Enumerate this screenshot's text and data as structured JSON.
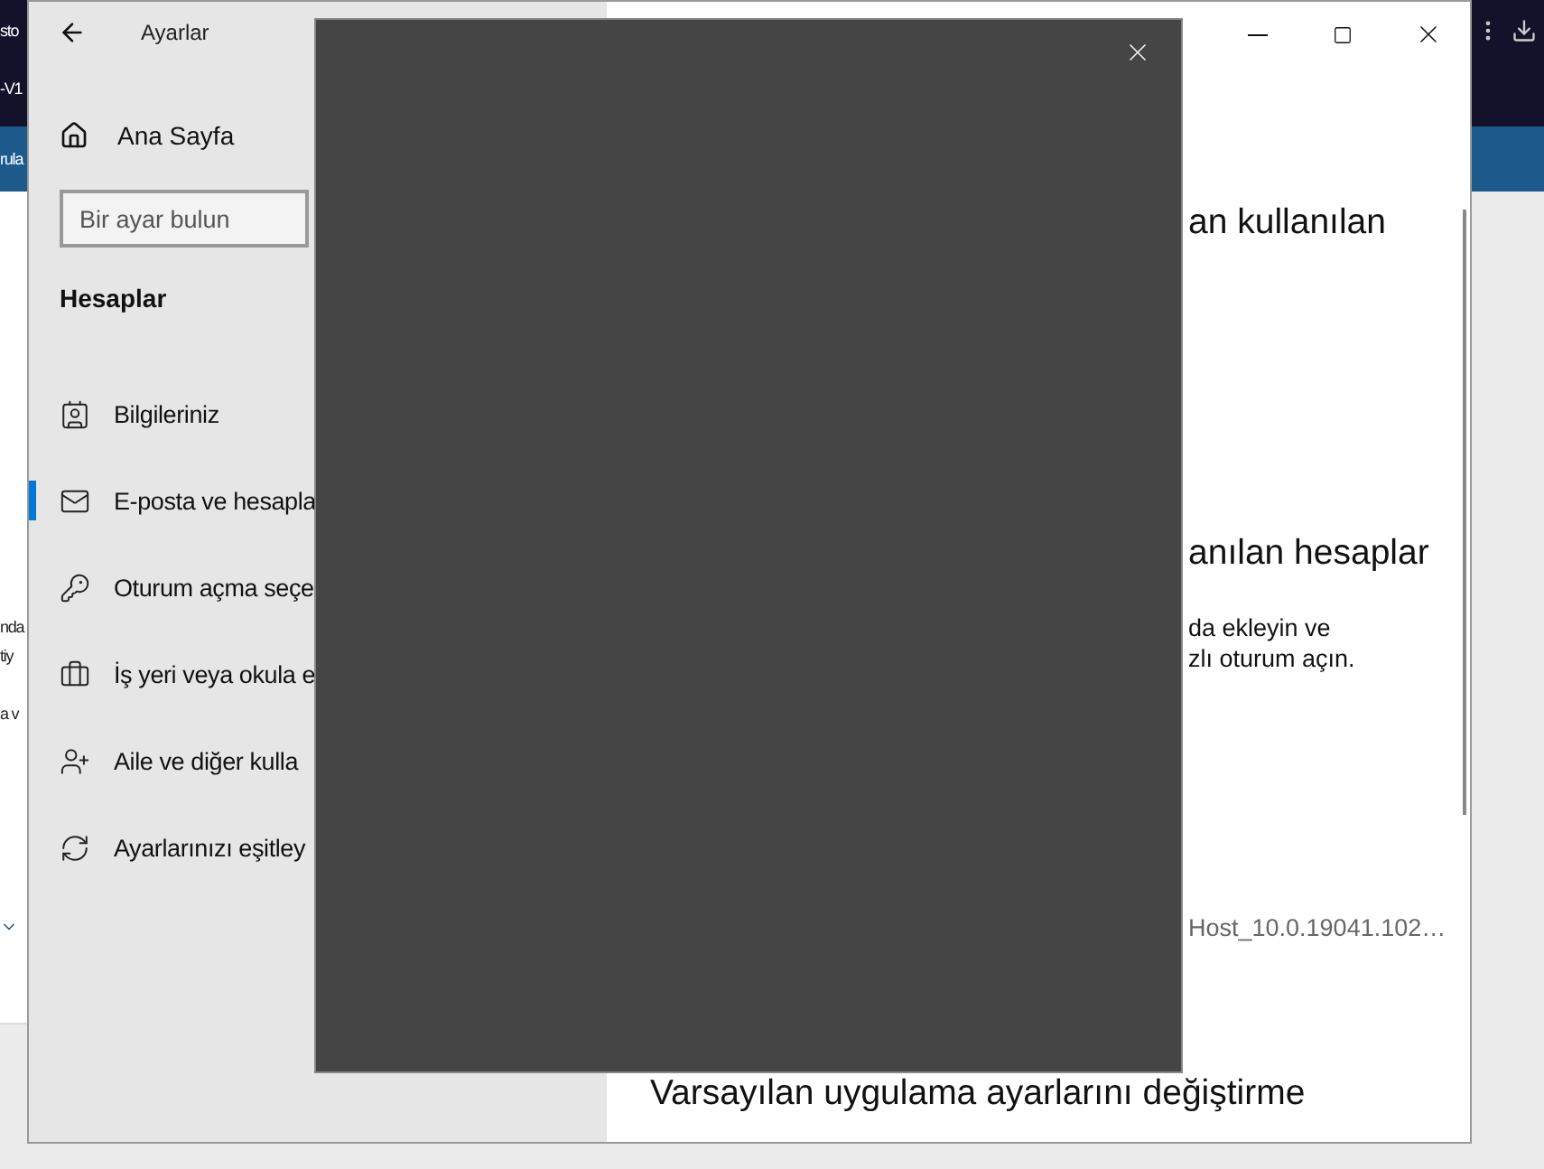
{
  "background": {
    "texts": [
      {
        "kind": "dark",
        "text": "sto"
      },
      {
        "kind": "dark",
        "text": "-V1"
      },
      {
        "kind": "band",
        "text": "rula"
      },
      {
        "kind": "page",
        "text": "nda"
      },
      {
        "kind": "page",
        "text": "tiy"
      },
      {
        "kind": "page",
        "text": "a v"
      }
    ]
  },
  "window": {
    "title": "Ayarlar",
    "home": "Ana Sayfa",
    "search": {
      "placeholder": "Bir ayar bulun"
    },
    "section": "Hesaplar",
    "nav": [
      {
        "label": "Bilgileriniz",
        "selected": false
      },
      {
        "label": "E-posta ve hesapla",
        "selected": true
      },
      {
        "label": "Oturum açma seçe",
        "selected": false
      },
      {
        "label": "İş yeri veya okula e",
        "selected": false
      },
      {
        "label": "Aile ve diğer kulla",
        "selected": false
      },
      {
        "label": "Ayarlarınızı eşitley",
        "selected": false
      }
    ],
    "content": [
      {
        "kind": "heading",
        "text": "an kullanılan"
      },
      {
        "kind": "heading",
        "text": "anılan hesaplar"
      },
      {
        "kind": "body",
        "text": "da ekleyin ve"
      },
      {
        "kind": "body",
        "text": "zlı oturum açın."
      },
      {
        "kind": "muted",
        "text": "Host_10.0.19041.102…"
      },
      {
        "kind": "title",
        "text": "Varsayılan uygulama ayarlarını değiştirme"
      }
    ]
  }
}
